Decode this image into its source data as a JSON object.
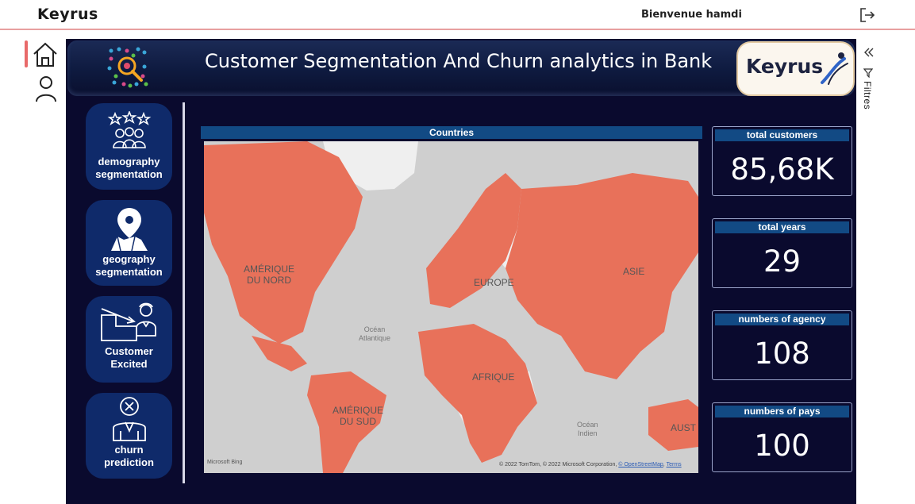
{
  "app": {
    "brand": "Keyrus",
    "welcome": "Bienvenue hamdi"
  },
  "filters": {
    "label": "Filtres"
  },
  "report": {
    "title": "Customer Segmentation And Churn analytics in Bank",
    "logo_text": "Keyrus"
  },
  "nav": [
    {
      "label_line1": "demography",
      "label_line2": "segmentation",
      "icon": "users-stars-icon"
    },
    {
      "label_line1": "geography",
      "label_line2": "segmentation",
      "icon": "map-pin-icon"
    },
    {
      "label_line1": "Customer",
      "label_line2": "Excited",
      "icon": "customer-exit-icon"
    },
    {
      "label_line1": "churn",
      "label_line2": "prediction",
      "icon": "churn-person-icon"
    }
  ],
  "map": {
    "title": "Countries",
    "labels": {
      "north_america": "AMÉRIQUE\nDU NORD",
      "south_america": "AMÉRIQUE\nDU SUD",
      "europe": "EUROPE",
      "asia": "ASIE",
      "africa": "AFRIQUE",
      "australia": "AUST"
    },
    "oceans": {
      "atlantic": "Océan\nAtlantique",
      "indian": "Océan\nIndien"
    },
    "attribution": {
      "bing": "Microsoft Bing",
      "copyright": "© 2022 TomTom, © 2022 Microsoft Corporation,",
      "osm_link": "© OpenStreetMap",
      "terms_link": "Terms"
    },
    "colors": {
      "highlight": "#e8715a",
      "land": "#efefef",
      "water": "#cfcfcf"
    }
  },
  "kpis": [
    {
      "title": "total customers",
      "value": "85,68K"
    },
    {
      "title": "total years",
      "value": "29"
    },
    {
      "title": "numbers of agency",
      "value": "108"
    },
    {
      "title": "numbers of pays",
      "value": "100"
    }
  ]
}
